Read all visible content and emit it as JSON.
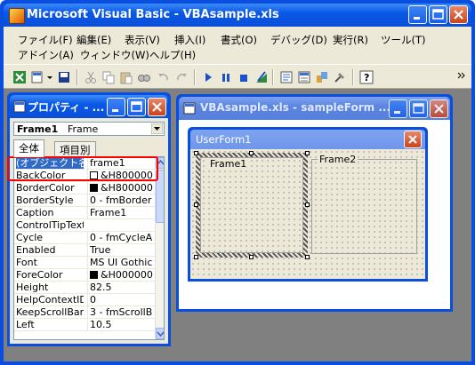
{
  "app": {
    "title": "Microsoft Visual Basic - VBAsample.xls"
  },
  "menu": {
    "row1": [
      "ファイル(F)",
      "編集(E)",
      "表示(V)",
      "挿入(I)",
      "書式(O)",
      "デバッグ(D)",
      "実行(R)",
      "ツール(T)"
    ],
    "row2": [
      "アドイン(A)",
      "ウィンドウ(W)",
      "ヘルプ(H)"
    ]
  },
  "properties": {
    "title": "プロパティ - ...",
    "object_name": "Frame1",
    "object_type": "Frame",
    "tabs": [
      "全体",
      "項目別"
    ],
    "rows": [
      {
        "name": "(オブジェクト名)",
        "value": "frame1"
      },
      {
        "name": "BackColor",
        "value": "&H800000"
      },
      {
        "name": "BorderColor",
        "value": "&H800000"
      },
      {
        "name": "BorderStyle",
        "value": "0 - fmBorder"
      },
      {
        "name": "Caption",
        "value": "Frame1"
      },
      {
        "name": "ControlTipText",
        "value": ""
      },
      {
        "name": "Cycle",
        "value": "0 - fmCycleA"
      },
      {
        "name": "Enabled",
        "value": "True"
      },
      {
        "name": "Font",
        "value": "MS UI Gothic"
      },
      {
        "name": "ForeColor",
        "value": "&H000000"
      },
      {
        "name": "Height",
        "value": "82.5"
      },
      {
        "name": "HelpContextID",
        "value": "0"
      },
      {
        "name": "KeepScrollBars",
        "value": "3 - fmScrollB"
      },
      {
        "name": "Left",
        "value": "10.5"
      }
    ]
  },
  "designer": {
    "title": "VBAsample.xls - sampleForm ...",
    "userform_title": "UserForm1",
    "frame1_label": "Frame1",
    "frame2_label": "Frame2"
  },
  "colors": {
    "accent": "#0a4ee0",
    "highlight": "#ff0000"
  }
}
